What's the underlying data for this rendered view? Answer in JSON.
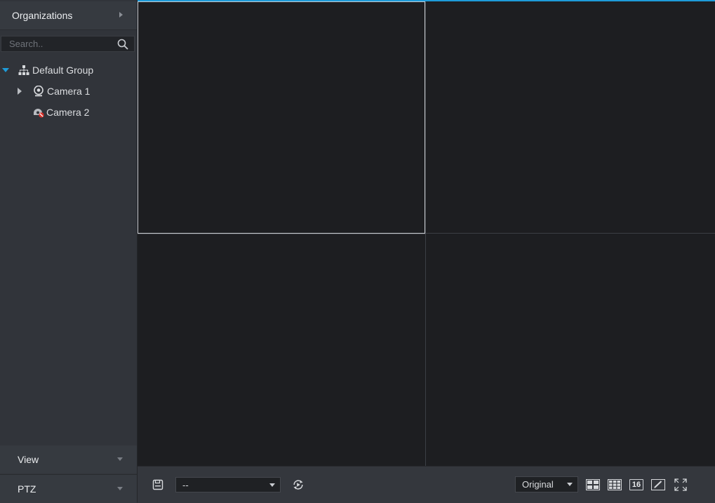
{
  "sidebar": {
    "header": {
      "title": "Organizations"
    },
    "search": {
      "placeholder": "Search.."
    },
    "tree": {
      "group": {
        "label": "Default Group"
      },
      "items": [
        {
          "label": "Camera 1",
          "status": "online"
        },
        {
          "label": "Camera 2",
          "status": "offline"
        }
      ]
    },
    "footer": {
      "view": {
        "label": "View"
      },
      "ptz": {
        "label": "PTZ"
      }
    }
  },
  "grid": {
    "layout": "2x2",
    "selected_pane": 1
  },
  "toolbar": {
    "view_select": {
      "value": "--"
    },
    "aspect_select": {
      "value": "Original"
    },
    "layout_16_label": "16"
  },
  "colors": {
    "accent": "#1e9bd9",
    "background": "#2d3035",
    "pane": "#1d1e21"
  }
}
